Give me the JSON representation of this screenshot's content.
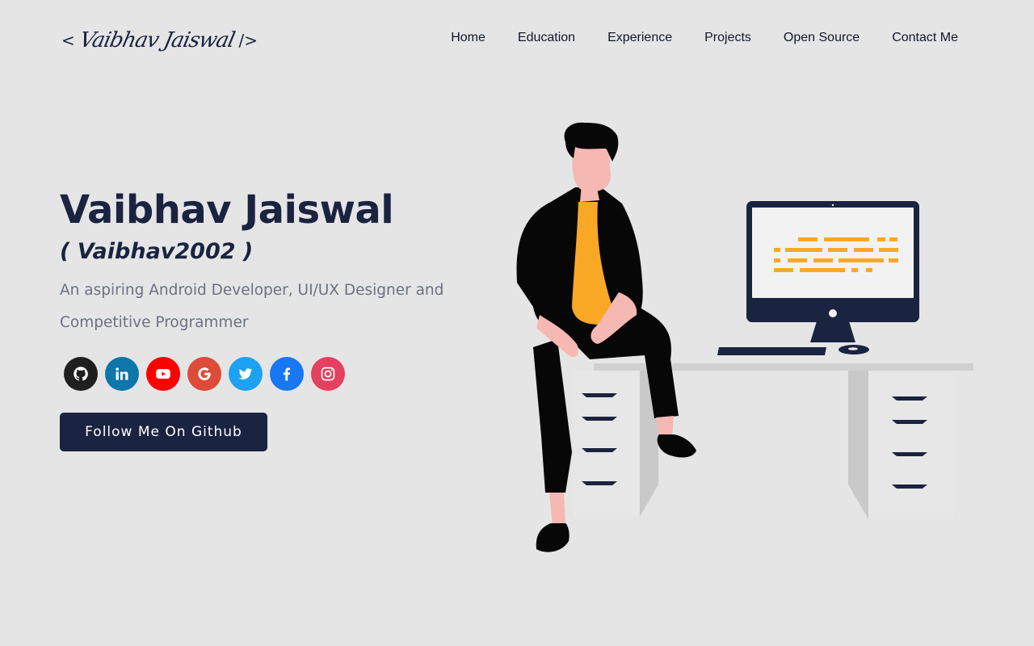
{
  "header": {
    "logo": {
      "open_bracket": "<",
      "signature": "Vaibhav Jaiswal",
      "close_bracket": "/>"
    },
    "nav": [
      {
        "label": "Home"
      },
      {
        "label": "Education"
      },
      {
        "label": "Experience"
      },
      {
        "label": "Projects"
      },
      {
        "label": "Open Source"
      },
      {
        "label": "Contact Me"
      }
    ]
  },
  "hero": {
    "name": "Vaibhav Jaiswal",
    "handle": "( Vaibhav2002 )",
    "tagline": "An aspiring Android Developer, UI/UX Designer and Competitive Programmer",
    "cta_label": "Follow Me On Github"
  },
  "socials": [
    {
      "icon": "github-icon",
      "color": "#1f1f1f"
    },
    {
      "icon": "linkedin-icon",
      "color": "#0e76a8"
    },
    {
      "icon": "youtube-icon",
      "color": "#ff0000"
    },
    {
      "icon": "google-icon",
      "color": "#dd4b39"
    },
    {
      "icon": "twitter-icon",
      "color": "#1da1f2"
    },
    {
      "icon": "facebook-icon",
      "color": "#1877f2"
    },
    {
      "icon": "instagram-icon",
      "color": "#e4405f"
    }
  ],
  "colors": {
    "background": "#e5e5e6",
    "primary": "#1a2340",
    "accent": "#f9a826",
    "muted_text": "#6b7180"
  }
}
